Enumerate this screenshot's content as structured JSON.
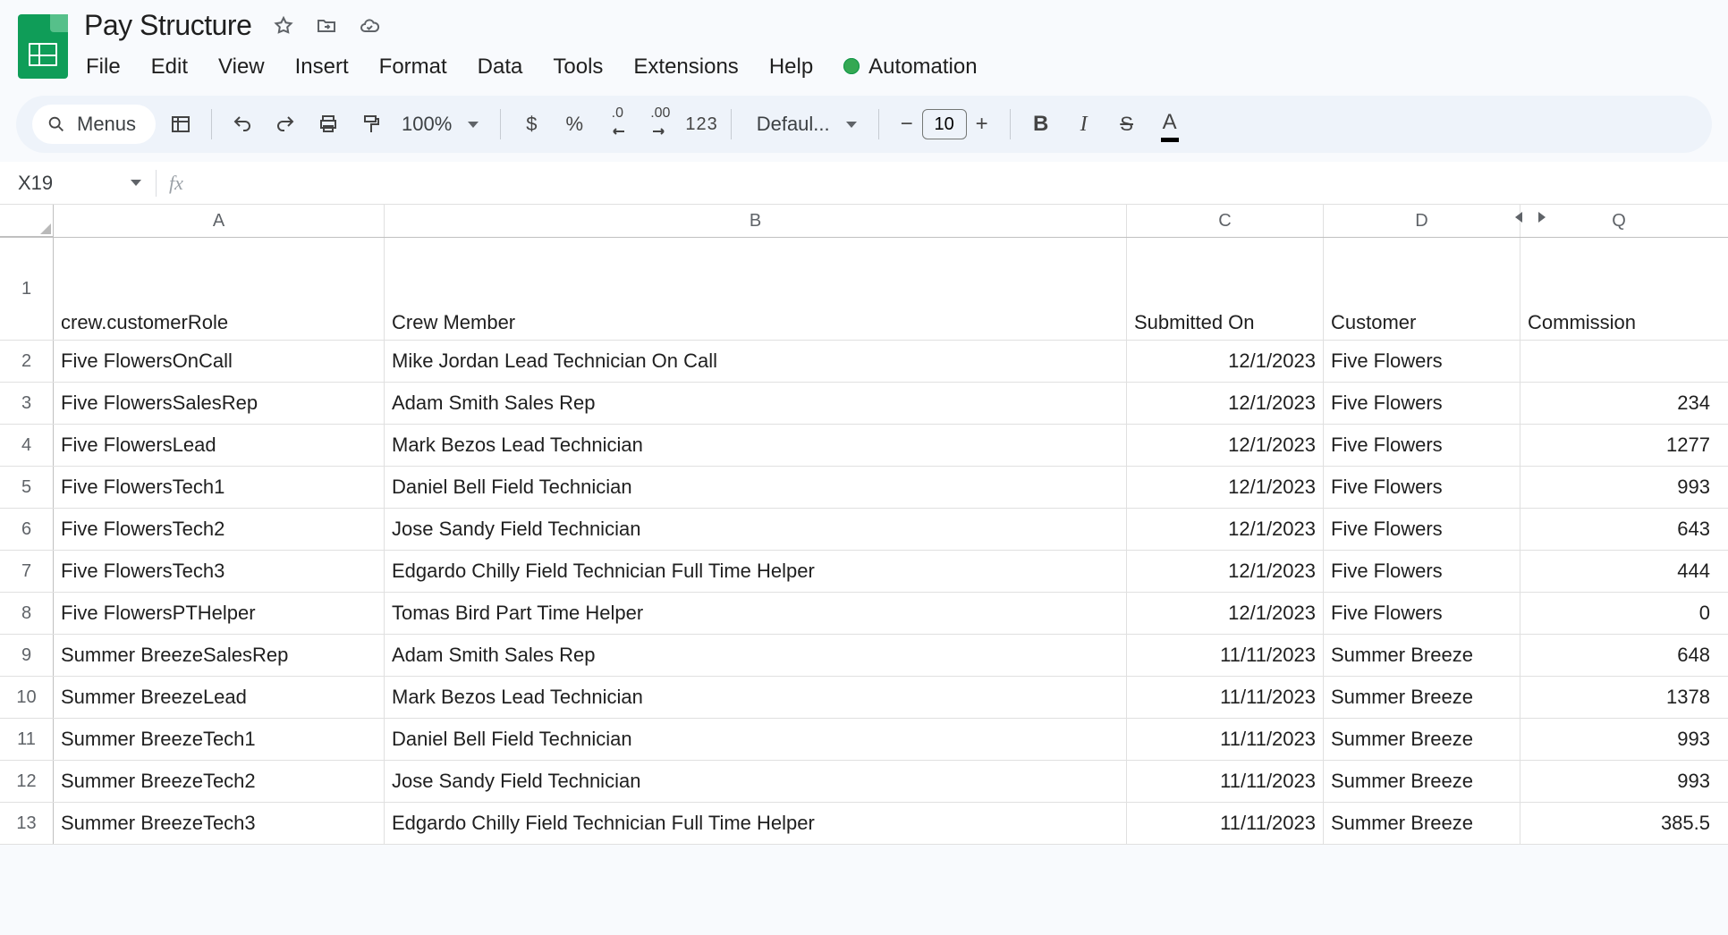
{
  "doc": {
    "title": "Pay Structure"
  },
  "menus_pill": "Menus",
  "menu": {
    "file": "File",
    "edit": "Edit",
    "view": "View",
    "insert": "Insert",
    "format": "Format",
    "data": "Data",
    "tools": "Tools",
    "extensions": "Extensions",
    "help": "Help",
    "automation": "Automation"
  },
  "toolbar": {
    "zoom": "100%",
    "currency": "$",
    "percent": "%",
    "dec_dec": ".0",
    "dec_inc": ".00",
    "num123": "123",
    "font": "Defaul...",
    "font_size": "10"
  },
  "namebox": "X19",
  "fx_symbol": "fx",
  "columns": {
    "A": "A",
    "B": "B",
    "C": "C",
    "D": "D",
    "Q": "Q"
  },
  "headers": {
    "A": "crew.customerRole",
    "B": "Crew Member",
    "C": "Submitted On",
    "D": "Customer",
    "Q": "Commission"
  },
  "rows": [
    {
      "n": "2",
      "A": "Five FlowersOnCall",
      "B": "Mike Jordan Lead Technician On Call",
      "C": "12/1/2023",
      "D": "Five Flowers",
      "Q": ""
    },
    {
      "n": "3",
      "A": "Five FlowersSalesRep",
      "B": "Adam Smith Sales Rep",
      "C": "12/1/2023",
      "D": "Five Flowers",
      "Q": "234"
    },
    {
      "n": "4",
      "A": "Five FlowersLead",
      "B": "Mark Bezos Lead Technician",
      "C": "12/1/2023",
      "D": "Five Flowers",
      "Q": "1277"
    },
    {
      "n": "5",
      "A": "Five FlowersTech1",
      "B": "Daniel Bell Field Technician",
      "C": "12/1/2023",
      "D": "Five Flowers",
      "Q": "993"
    },
    {
      "n": "6",
      "A": "Five FlowersTech2",
      "B": "Jose Sandy Field Technician",
      "C": "12/1/2023",
      "D": "Five Flowers",
      "Q": "643"
    },
    {
      "n": "7",
      "A": "Five FlowersTech3",
      "B": "Edgardo Chilly Field Technician Full Time Helper",
      "C": "12/1/2023",
      "D": "Five Flowers",
      "Q": "444"
    },
    {
      "n": "8",
      "A": "Five FlowersPTHelper",
      "B": "Tomas Bird Part Time Helper",
      "C": "12/1/2023",
      "D": "Five Flowers",
      "Q": "0"
    },
    {
      "n": "9",
      "A": "Summer BreezeSalesRep",
      "B": "Adam Smith Sales Rep",
      "C": "11/11/2023",
      "D": "Summer Breeze",
      "Q": "648"
    },
    {
      "n": "10",
      "A": "Summer BreezeLead",
      "B": "Mark Bezos Lead Technician",
      "C": "11/11/2023",
      "D": "Summer Breeze",
      "Q": "1378"
    },
    {
      "n": "11",
      "A": "Summer BreezeTech1",
      "B": "Daniel Bell Field Technician",
      "C": "11/11/2023",
      "D": "Summer Breeze",
      "Q": "993"
    },
    {
      "n": "12",
      "A": "Summer BreezeTech2",
      "B": "Jose Sandy Field Technician",
      "C": "11/11/2023",
      "D": "Summer Breeze",
      "Q": "993"
    },
    {
      "n": "13",
      "A": "Summer BreezeTech3",
      "B": "Edgardo Chilly Field Technician Full Time Helper",
      "C": "11/11/2023",
      "D": "Summer Breeze",
      "Q": "385.5"
    }
  ],
  "row1_n": "1"
}
